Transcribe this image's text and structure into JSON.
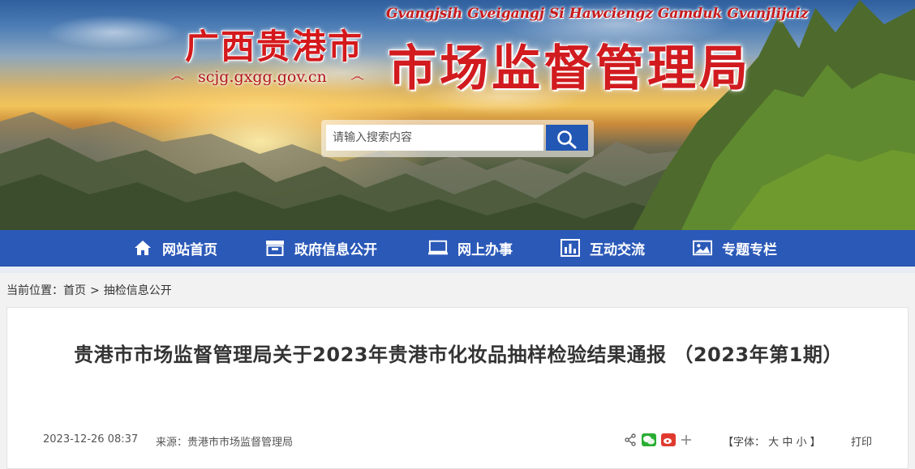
{
  "banner": {
    "site_name_small": "广西贵港市",
    "site_domain": "scjg.gxgg.gov.cn",
    "zhuang_name": "Gvangjsih Gveigangj Si Hawciengz Gamduk Gvanjlijaiz",
    "site_name_big": "市场监督管理局"
  },
  "search": {
    "placeholder": "请输入搜索内容",
    "icon": "search-icon"
  },
  "nav": {
    "items": [
      {
        "label": "网站首页",
        "icon": "home-icon"
      },
      {
        "label": "政府信息公开",
        "icon": "archive-icon"
      },
      {
        "label": "网上办事",
        "icon": "monitor-icon"
      },
      {
        "label": "互动交流",
        "icon": "bar-chart-icon"
      },
      {
        "label": "专题专栏",
        "icon": "image-icon"
      }
    ]
  },
  "breadcrumb": {
    "prefix": "当前位置：",
    "home": "首页",
    "separator": ">",
    "current": "抽检信息公开"
  },
  "article": {
    "title": "贵港市市场监督管理局关于2023年贵港市化妆品抽样检验结果通报 （2023年第1期）",
    "date": "2023-12-26 08:37",
    "source": "来源：贵港市市场监督管理局",
    "share_icons": [
      "share-icon",
      "wechat-icon",
      "weibo-icon",
      "plus-icon"
    ],
    "font_size_label": "【字体：",
    "font_large": "大",
    "font_medium": "中",
    "font_small": "小",
    "font_size_end": "】",
    "print_label": "打印"
  },
  "colors": {
    "nav_blue": "#2b59b8",
    "title_red": "#d11b1f",
    "search_button": "#2257b4"
  }
}
